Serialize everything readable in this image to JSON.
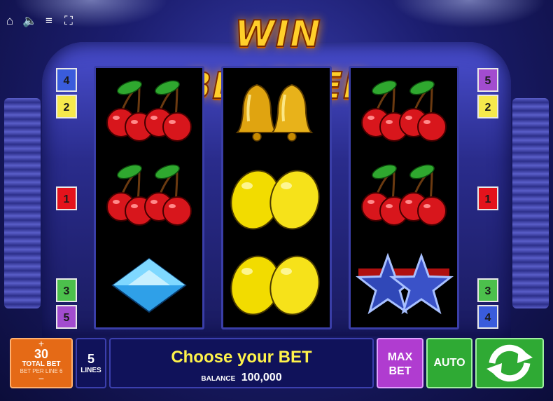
{
  "top_icons": [
    {
      "name": "home-icon",
      "glyph": "⌂"
    },
    {
      "name": "sound-icon",
      "glyph": "🔈"
    },
    {
      "name": "menu-icon",
      "glyph": "≡"
    },
    {
      "name": "fullscreen-icon",
      "glyph": "⛶"
    }
  ],
  "logo": "WIN BLASTER",
  "reels": [
    [
      "cherries",
      "cherries",
      "diamond"
    ],
    [
      "bells",
      "lemons",
      "lemons"
    ],
    [
      "cherries",
      "cherries",
      "stars"
    ]
  ],
  "line_numbers": {
    "left": [
      {
        "label": "4",
        "color": "#3a5cdc"
      },
      {
        "label": "2",
        "color": "#f6e94c"
      },
      {
        "label": "1",
        "color": "#e4131c"
      },
      {
        "label": "3",
        "color": "#4cc04c"
      },
      {
        "label": "5",
        "color": "#a24ccf"
      }
    ],
    "right": [
      {
        "label": "5",
        "color": "#a24ccf"
      },
      {
        "label": "2",
        "color": "#f6e94c"
      },
      {
        "label": "1",
        "color": "#e4131c"
      },
      {
        "label": "3",
        "color": "#4cc04c"
      },
      {
        "label": "4",
        "color": "#3a5cdc"
      }
    ]
  },
  "bottom_bar": {
    "total_bet": {
      "plus": "+",
      "value": "30",
      "label": "TOTAL BET",
      "bet_per_line_label": "BET PER LINE",
      "bet_per_line_value": "6",
      "minus": "−"
    },
    "lines": {
      "value": "5",
      "label": "LINES"
    },
    "message": "Choose your BET",
    "balance": {
      "label": "BALANCE",
      "value": "100,000"
    },
    "max_bet": {
      "line1": "MAX",
      "line2": "BET"
    },
    "auto": "AUTO"
  },
  "colors": {
    "accent_green": "#2faa34",
    "accent_orange": "#e56a16",
    "accent_purple": "#b03cd0",
    "message_yellow": "#fff34a"
  }
}
